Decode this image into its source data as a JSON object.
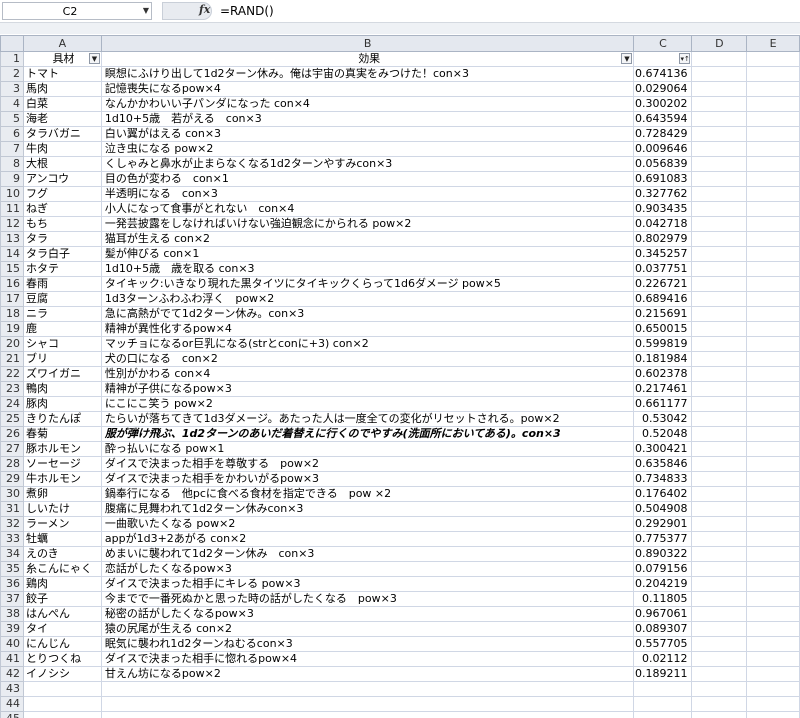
{
  "formula_bar": {
    "name_box": "C2",
    "fx_label": "fx",
    "formula": "=RAND()"
  },
  "columns": [
    "A",
    "B",
    "C",
    "D",
    "E"
  ],
  "headers": {
    "a": "具材",
    "b": "効果",
    "c": ""
  },
  "rows": [
    {
      "a": "トマト",
      "b": "瞑想にふけり出して1d2ターン休み。俺は宇宙の真実をみつけた！con×3",
      "c": "0.674136"
    },
    {
      "a": "馬肉",
      "b": "記憶喪失になるpow×4",
      "c": "0.029064"
    },
    {
      "a": "白菜",
      "b": "なんかかわいい子パンダになった con×4",
      "c": "0.300202"
    },
    {
      "a": "海老",
      "b": "1d10+5歳　若がえる　con×3",
      "c": "0.643594"
    },
    {
      "a": "タラバガニ",
      "b": "白い翼がはえる con×3",
      "c": "0.728429"
    },
    {
      "a": "牛肉",
      "b": "泣き虫になる pow×2",
      "c": "0.009646"
    },
    {
      "a": "大根",
      "b": "くしゃみと鼻水が止まらなくなる1d2ターンやすみcon×3",
      "c": "0.056839"
    },
    {
      "a": "アンコウ",
      "b": "目の色が変わる　con×1",
      "c": "0.691083"
    },
    {
      "a": "フグ",
      "b": "半透明になる　con×3",
      "c": "0.327762"
    },
    {
      "a": "ねぎ",
      "b": "小人になって食事がとれない　con×4",
      "c": "0.903435"
    },
    {
      "a": "もち",
      "b": "一発芸披露をしなければいけない強迫観念にかられる pow×2",
      "c": "0.042718"
    },
    {
      "a": "タラ",
      "b": "猫耳が生える con×2",
      "c": "0.802979"
    },
    {
      "a": "タラ白子",
      "b": "髪が伸びる con×1",
      "c": "0.345257"
    },
    {
      "a": "ホタテ",
      "b": "1d10+5歳　歳を取る con×3",
      "c": "0.037751"
    },
    {
      "a": "春雨",
      "b": "タイキック:いきなり現れた黒タイツにタイキックくらって1d6ダメージ pow×5",
      "c": "0.226721"
    },
    {
      "a": "豆腐",
      "b": "1d3ターンふわふわ浮く　pow×2",
      "c": "0.689416"
    },
    {
      "a": "ニラ",
      "b": "急に高熱がでて1d2ターン休み。con×3",
      "c": "0.215691"
    },
    {
      "a": "鹿",
      "b": "精神が異性化するpow×4",
      "c": "0.650015"
    },
    {
      "a": "シャコ",
      "b": "マッチョになるor巨乳になる(strとconに+3) con×2",
      "c": "0.599819"
    },
    {
      "a": "ブリ",
      "b": "犬の口になる　con×2",
      "c": "0.181984"
    },
    {
      "a": "ズワイガニ",
      "b": "性別がかわる con×4",
      "c": "0.602378"
    },
    {
      "a": "鴨肉",
      "b": "精神が子供になるpow×3",
      "c": "0.217461"
    },
    {
      "a": "豚肉",
      "b": "にこにこ笑う pow×2",
      "c": "0.661177"
    },
    {
      "a": "きりたんぽ",
      "b": "たらいが落ちてきて1d3ダメージ。あたった人は一度全ての変化がリセットされる。pow×2",
      "c": "0.53042"
    },
    {
      "a": "春菊",
      "b": "服が弾け飛ぶ、1d2ターンのあいだ着替えに行くのでやすみ(洗面所においてある)。con×3",
      "c": "0.52048",
      "style": "bolditalic"
    },
    {
      "a": "豚ホルモン",
      "b": "酔っ払いになる pow×1",
      "c": "0.300421"
    },
    {
      "a": "ソーセージ",
      "b": "ダイスで決まった相手を尊敬する　pow×2",
      "c": "0.635846"
    },
    {
      "a": "牛ホルモン",
      "b": "ダイスで決まった相手をかわいがるpow×3",
      "c": "0.734833"
    },
    {
      "a": "煮卵",
      "b": "鍋奉行になる　他pcに食べる食材を指定できる　pow ×2",
      "c": "0.176402"
    },
    {
      "a": "しいたけ",
      "b": "腹痛に見舞われて1d2ターン休みcon×3",
      "c": "0.504908"
    },
    {
      "a": "ラーメン",
      "b": "一曲歌いたくなる pow×2",
      "c": "0.292901"
    },
    {
      "a": "牡蠣",
      "b": "appが1d3+2あがる con×2",
      "c": "0.775377"
    },
    {
      "a": "えのき",
      "b": "めまいに襲われて1d2ターン休み　con×3",
      "c": "0.890322"
    },
    {
      "a": "糸こんにゃく",
      "b": "恋話がしたくなるpow×3",
      "c": "0.079156"
    },
    {
      "a": "鶏肉",
      "b": "ダイスで決まった相手にキレる pow×3",
      "c": "0.204219"
    },
    {
      "a": "餃子",
      "b": "今までで一番死ぬかと思った時の話がしたくなる　pow×3",
      "c": "0.11805"
    },
    {
      "a": "はんぺん",
      "b": "秘密の話がしたくなるpow×3",
      "c": "0.967061"
    },
    {
      "a": "タイ",
      "b": "猿の尻尾が生える con×2",
      "c": "0.089307"
    },
    {
      "a": "にんじん",
      "b": "眠気に襲われ1d2ターンねむるcon×3",
      "c": "0.557705"
    },
    {
      "a": "とりつくね",
      "b": "ダイスで決まった相手に惚れるpow×4",
      "c": "0.02112"
    },
    {
      "a": "イノシシ",
      "b": "甘えん坊になるpow×2",
      "c": "0.189211"
    }
  ]
}
